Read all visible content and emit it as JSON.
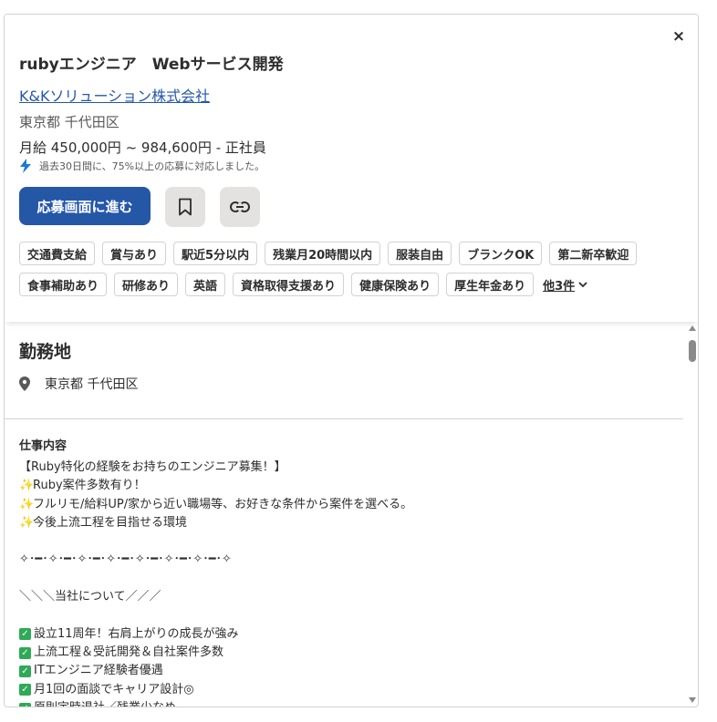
{
  "header": {
    "close_label": "×",
    "title": "rubyエンジニア　Webサービス開発",
    "company": "K&Kソリューション株式会社",
    "location": "東京都 千代田区",
    "salary": "月給 450,000円 ~ 984,600円  - 正社員",
    "response_note": "過去30日間に、75%以上の応募に対応しました。",
    "apply_label": "応募画面に進む",
    "save_icon": "bookmark-icon",
    "link_icon": "link-icon"
  },
  "tags": {
    "row1": [
      "交通費支給",
      "賞与あり",
      "駅近5分以内",
      "残業月20時間以内",
      "服装自由",
      "ブランクOK",
      "第二新卒歓迎"
    ],
    "row2": [
      "食事補助あり",
      "研修あり",
      "英語",
      "資格取得支援あり",
      "健康保険あり",
      "厚生年金あり"
    ],
    "more_label": "他3件"
  },
  "workplace": {
    "title": "勤務地",
    "location": "東京都 千代田区"
  },
  "description": {
    "heading": "仕事内容",
    "lines": {
      "l1": "【Ruby特化の経験をお持ちのエンジニア募集！】",
      "l2": "Ruby案件多数有り！",
      "l3": "フルリモ/給料UP/家から近い職場等、お好きな条件から案件を選べる。",
      "l4": "今後上流工程を目指せる環境",
      "l5": "✧･━･✧･━･✧･━･✧･━･✧･━･✧･━･✧･━･✧",
      "l6": "＼＼＼当社について／／／",
      "l7": "設立11周年！右肩上がりの成長が強み",
      "l8": "上流工程＆受託開発＆自社案件多数",
      "l9": "ITエンジニア経験者優遇",
      "l10": "月1回の面談でキャリア設計◎",
      "l11": "原則定時退社／残業少なめ"
    }
  },
  "colors": {
    "accent": "#2557a7",
    "check": "#2eaa57",
    "sparkle": "#f5a623",
    "bolt": "#1a7ad4"
  }
}
